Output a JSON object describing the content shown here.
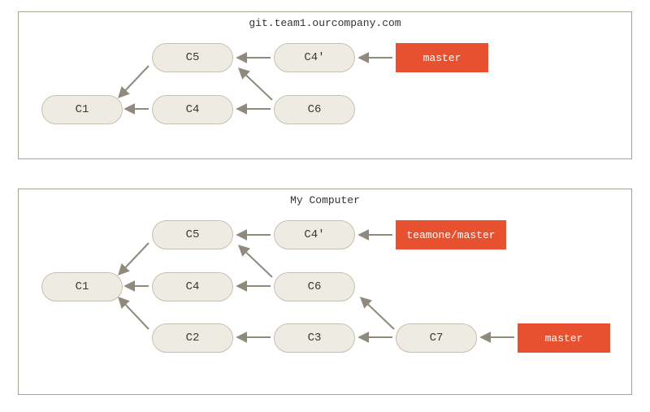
{
  "top": {
    "title": "git.team1.ourcompany.com",
    "commits": {
      "c1": "C1",
      "c4": "C4",
      "c5": "C5",
      "c6": "C6",
      "c4p": "C4'"
    },
    "refs": {
      "master": "master"
    }
  },
  "bottom": {
    "title": "My Computer",
    "commits": {
      "c1": "C1",
      "c2": "C2",
      "c3": "C3",
      "c4": "C4",
      "c5": "C5",
      "c6": "C6",
      "c4p": "C4'",
      "c7": "C7"
    },
    "refs": {
      "teamone_master": "teamone/master",
      "master": "master"
    }
  },
  "chart_data": [
    {
      "type": "graph",
      "title": "git.team1.ourcompany.com",
      "nodes": [
        "C1",
        "C4",
        "C5",
        "C6",
        "C4'"
      ],
      "edges": [
        {
          "from": "C5",
          "to": "C1"
        },
        {
          "from": "C4",
          "to": "C1"
        },
        {
          "from": "C4'",
          "to": "C5"
        },
        {
          "from": "C6",
          "to": "C5"
        },
        {
          "from": "C6",
          "to": "C4"
        }
      ],
      "refs": [
        {
          "name": "master",
          "points_to": "C4'"
        }
      ]
    },
    {
      "type": "graph",
      "title": "My Computer",
      "nodes": [
        "C1",
        "C2",
        "C3",
        "C4",
        "C5",
        "C6",
        "C4'",
        "C7"
      ],
      "edges": [
        {
          "from": "C5",
          "to": "C1"
        },
        {
          "from": "C4",
          "to": "C1"
        },
        {
          "from": "C2",
          "to": "C1"
        },
        {
          "from": "C4'",
          "to": "C5"
        },
        {
          "from": "C6",
          "to": "C5"
        },
        {
          "from": "C6",
          "to": "C4"
        },
        {
          "from": "C3",
          "to": "C2"
        },
        {
          "from": "C7",
          "to": "C6"
        },
        {
          "from": "C7",
          "to": "C3"
        }
      ],
      "refs": [
        {
          "name": "teamone/master",
          "points_to": "C4'"
        },
        {
          "name": "master",
          "points_to": "C7"
        }
      ]
    }
  ]
}
